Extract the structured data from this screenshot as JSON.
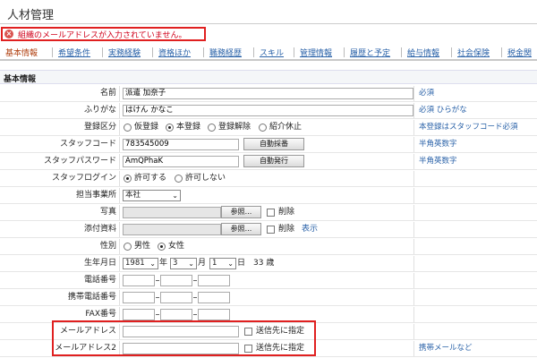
{
  "header": {
    "title": "人材管理"
  },
  "error": {
    "message": "組織のメールアドレスが入力されていません。"
  },
  "tabs": [
    "基本情報",
    "希望条件",
    "実務経験",
    "資格ほか",
    "職務経歴",
    "スキル",
    "管理情報",
    "履歴と予定",
    "給与情報",
    "社会保険",
    "税金関"
  ],
  "section": {
    "title": "基本情報"
  },
  "fields": {
    "name": {
      "label": "名前",
      "value": "派遣 加奈子",
      "note": "必須"
    },
    "furigana": {
      "label": "ふりがな",
      "value": "はけん かなこ",
      "note": "必須 ひらがな"
    },
    "registration": {
      "label": "登録区分",
      "options": [
        "仮登録",
        "本登録",
        "登録解除",
        "紹介休止"
      ],
      "selected": "本登録",
      "note": "本登録はスタッフコード必須"
    },
    "staff_code": {
      "label": "スタッフコード",
      "value": "783545009",
      "button": "自動採番",
      "note": "半角英数字"
    },
    "staff_password": {
      "label": "スタッフパスワード",
      "value": "AmQPhaK",
      "button": "自動発行",
      "note": "半角英数字"
    },
    "staff_login": {
      "label": "スタッフログイン",
      "options": [
        "許可する",
        "許可しない"
      ],
      "selected": "許可する"
    },
    "office": {
      "label": "担当事業所",
      "value": "本社"
    },
    "photo": {
      "label": "写真",
      "button": "参照...",
      "delete": "削除"
    },
    "attachment": {
      "label": "添付資料",
      "button": "参照...",
      "delete": "削除",
      "show": "表示"
    },
    "gender": {
      "label": "性別",
      "options": [
        "男性",
        "女性"
      ],
      "selected": "女性"
    },
    "birthdate": {
      "label": "生年月日",
      "year": "1981",
      "month": "3",
      "day": "1",
      "year_unit": "年",
      "month_unit": "月",
      "day_unit": "日",
      "age": "33 歳"
    },
    "phone": {
      "label": "電話番号"
    },
    "mobile": {
      "label": "携帯電話番号"
    },
    "fax": {
      "label": "FAX番号"
    },
    "email": {
      "label": "メールアドレス",
      "check_label": "送信先に指定"
    },
    "email2": {
      "label": "メールアドレス2",
      "check_label": "送信先に指定",
      "note": "携帯メールなど"
    }
  },
  "colors": {
    "error": "#e02020",
    "link": "#2a62a8"
  }
}
